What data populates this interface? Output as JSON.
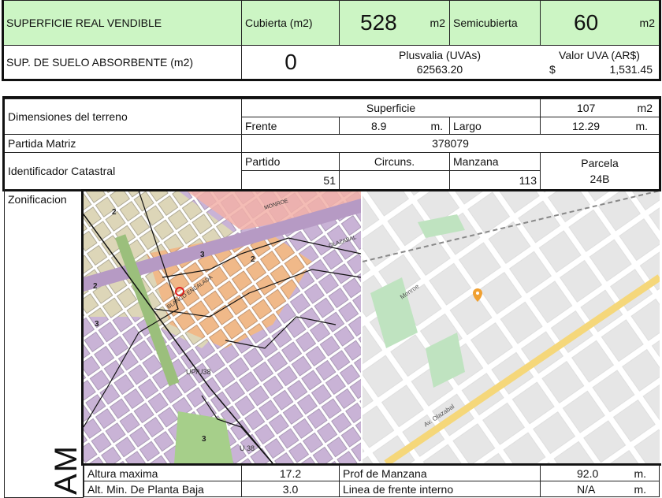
{
  "summary": {
    "superficie_label": "SUPERFICIE REAL VENDIBLE",
    "cubierta_label": "Cubierta (m2)",
    "cubierta_value": "528",
    "unit_m2": "m2",
    "semicubierta_label": "Semicubierta",
    "semicubierta_value": "60",
    "suelo_label": "SUP. DE SUELO ABSORBENTE (m2)",
    "suelo_value": "0",
    "plusvalia_label": "Plusvalia (UVAs)",
    "plusvalia_value": "62563.20",
    "uva_label": "Valor UVA (AR$)",
    "uva_currency": "$",
    "uva_value": "1,531.45"
  },
  "terreno": {
    "dimensiones_label": "Dimensiones del terreno",
    "superficie_label": "Superficie",
    "superficie_value": "107",
    "superficie_unit": "m2",
    "frente_label": "Frente",
    "frente_value": "8.9",
    "unit_m": "m.",
    "largo_label": "Largo",
    "largo_value": "12.29",
    "partida_label": "Partida Matriz",
    "partida_value": "378079",
    "catastral_label": "Identificador Catastral",
    "partido_label": "Partido",
    "partido_value": "51",
    "circuns_label": "Circuns.",
    "circuns_value": "",
    "manzana_label": "Manzana",
    "manzana_value": "113",
    "parcela_label": "Parcela",
    "parcela_value": "24B"
  },
  "zonificacion": {
    "label": "Zonificacion",
    "side_text": "AM",
    "map_labels": [
      "2",
      "3",
      "2",
      "2",
      "3",
      "MONROE",
      "OLAZABAL",
      "BLANCO ENCALADA",
      "UP/U38",
      "U 38",
      "3"
    ],
    "street_labels": [
      "Monroe",
      "Av. Olazabal"
    ]
  },
  "normas": {
    "altura_label": "Altura maxima",
    "altura_value": "17.2",
    "prof_label": "Prof de Manzana",
    "prof_value": "92.0",
    "unit_m": "m.",
    "altmin_label": "Alt. Min. De Planta Baja",
    "altmin_value": "3.0",
    "linea_label": "Linea de frente interno",
    "linea_value": "N/A"
  }
}
